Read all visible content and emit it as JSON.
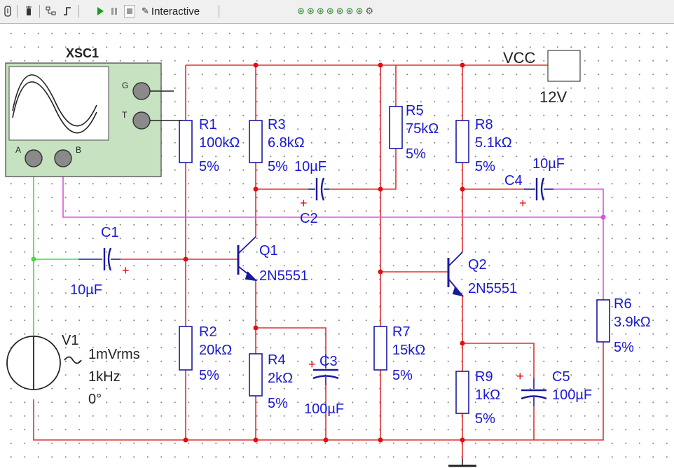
{
  "toolbar": {
    "mode_label": "Interactive",
    "colors": {
      "play": "#1c9a1c",
      "pause": "#9a9a9a",
      "stop": "#9a9a9a",
      "sim_icons": "#2f8a2f"
    }
  },
  "schematic": {
    "colors": {
      "wire": "#e03030",
      "probe_a": "#4ad64a",
      "probe_b": "#e050e0",
      "component": "#1a1aa0",
      "text": "#1a1ad0",
      "polarity": "#e00000",
      "junction": "#e01010",
      "scope_body": "#c6e2c0"
    },
    "oscilloscope": {
      "ref": "XSC1",
      "term_g": "G",
      "term_t": "T",
      "term_a": "A",
      "term_b": "B"
    },
    "vcc": {
      "label": "VCC",
      "value": "12V"
    },
    "source": {
      "ref": "V1",
      "amplitude": "1mVrms",
      "frequency": "1kHz",
      "phase": "0°"
    },
    "resistors": [
      {
        "ref": "R1",
        "value": "100kΩ",
        "tol": "5%"
      },
      {
        "ref": "R2",
        "value": "20kΩ",
        "tol": "5%"
      },
      {
        "ref": "R3",
        "value": "6.8kΩ",
        "tol": "5%"
      },
      {
        "ref": "R4",
        "value": "2kΩ",
        "tol": "5%"
      },
      {
        "ref": "R5",
        "value": "75kΩ",
        "tol": "5%"
      },
      {
        "ref": "R6",
        "value": "3.9kΩ",
        "tol": "5%"
      },
      {
        "ref": "R7",
        "value": "15kΩ",
        "tol": "5%"
      },
      {
        "ref": "R8",
        "value": "5.1kΩ",
        "tol": "5%"
      },
      {
        "ref": "R9",
        "value": "1kΩ",
        "tol": "5%"
      }
    ],
    "capacitors": [
      {
        "ref": "C1",
        "value": "10µF"
      },
      {
        "ref": "C2",
        "value": "10µF"
      },
      {
        "ref": "C3",
        "value": "100µF"
      },
      {
        "ref": "C4",
        "value": "10µF"
      },
      {
        "ref": "C5",
        "value": "100µF"
      }
    ],
    "transistors": [
      {
        "ref": "Q1",
        "model": "2N5551"
      },
      {
        "ref": "Q2",
        "model": "2N5551"
      }
    ],
    "polarity_mark": "+"
  }
}
